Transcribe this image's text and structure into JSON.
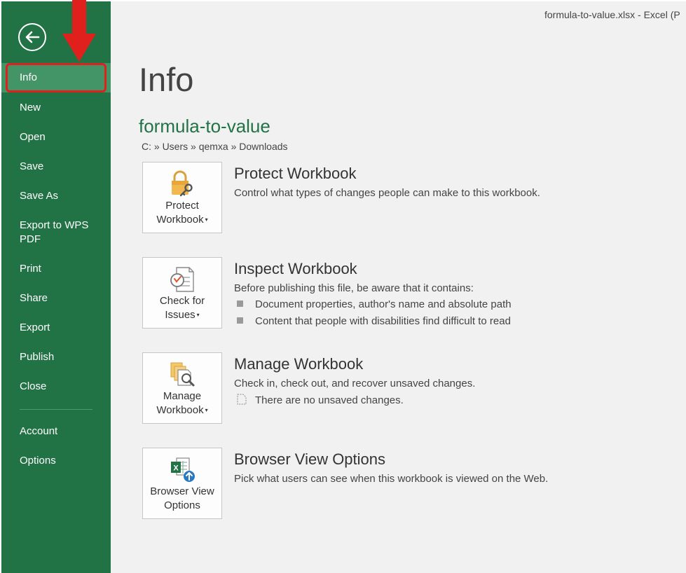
{
  "window": {
    "title": "formula-to-value.xlsx - Excel (P"
  },
  "sidebar": {
    "items": [
      {
        "label": "Info"
      },
      {
        "label": "New"
      },
      {
        "label": "Open"
      },
      {
        "label": "Save"
      },
      {
        "label": "Save As"
      },
      {
        "label": "Export to WPS PDF"
      },
      {
        "label": "Print"
      },
      {
        "label": "Share"
      },
      {
        "label": "Export"
      },
      {
        "label": "Publish"
      },
      {
        "label": "Close"
      },
      {
        "label": "Account"
      },
      {
        "label": "Options"
      }
    ]
  },
  "page": {
    "title": "Info",
    "doc_name": "formula-to-value",
    "path": "C: » Users » qemxa » Downloads"
  },
  "sections": {
    "protect": {
      "tile_line1": "Protect",
      "tile_line2": "Workbook",
      "title": "Protect Workbook",
      "desc": "Control what types of changes people can make to this workbook."
    },
    "inspect": {
      "tile_line1": "Check for",
      "tile_line2": "Issues",
      "title": "Inspect Workbook",
      "desc": "Before publishing this file, be aware that it contains:",
      "bullets": [
        "Document properties, author's name and absolute path",
        "Content that people with disabilities find difficult to read"
      ]
    },
    "manage": {
      "tile_line1": "Manage",
      "tile_line2": "Workbook",
      "title": "Manage Workbook",
      "desc": "Check in, check out, and recover unsaved changes.",
      "note": "There are no unsaved changes."
    },
    "browser": {
      "tile_line1": "Browser View",
      "tile_line2": "Options",
      "title": "Browser View Options",
      "desc": "Pick what users can see when this workbook is viewed on the Web."
    }
  },
  "colors": {
    "sidebar": "#217346",
    "sidebar_active": "#439467",
    "accent_green": "#217346",
    "annotation_red": "#e0201d"
  }
}
